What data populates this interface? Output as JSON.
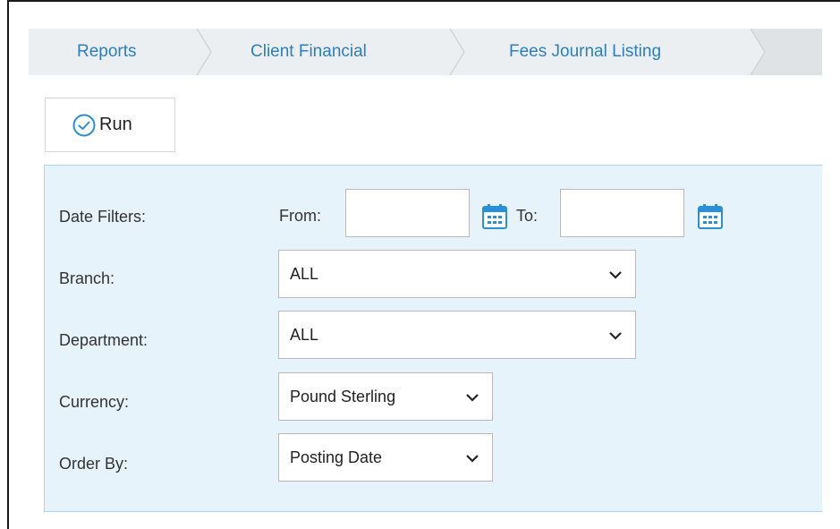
{
  "breadcrumb": {
    "items": [
      {
        "label": "Reports"
      },
      {
        "label": "Client Financial"
      },
      {
        "label": "Fees Journal Listing"
      }
    ]
  },
  "toolbar": {
    "run_label": "Run"
  },
  "filters": {
    "date": {
      "label": "Date Filters:",
      "from_label": "From:",
      "from_value": "",
      "to_label": "To:",
      "to_value": ""
    },
    "branch": {
      "label": "Branch:",
      "value": "ALL"
    },
    "department": {
      "label": "Department:",
      "value": "ALL"
    },
    "currency": {
      "label": "Currency:",
      "value": "Pound Sterling"
    },
    "order_by": {
      "label": "Order By:",
      "value": "Posting Date"
    }
  },
  "icons": {
    "run": "check-circle-icon",
    "calendar": "calendar-icon",
    "dropdown": "chevron-down-icon"
  },
  "colors": {
    "link": "#2a7fc1",
    "accent": "#2a8fd6",
    "panel_bg": "#e6f3fb",
    "panel_border": "#a9d3ef"
  }
}
